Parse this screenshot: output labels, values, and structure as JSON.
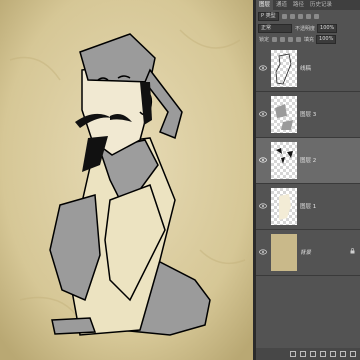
{
  "panel": {
    "tabs": [
      {
        "label": "图层"
      },
      {
        "label": "通道"
      },
      {
        "label": "路径"
      },
      {
        "label": "历史记录"
      }
    ],
    "kind_field": "P 类型",
    "blend_mode": "正常",
    "opacity_label": "不透明度",
    "opacity_value": "100%",
    "lock_label": "锁定",
    "fill_label": "填充",
    "fill_value": "100%"
  },
  "layers": [
    {
      "name": "线稿",
      "selected": false
    },
    {
      "name": "图层 3",
      "selected": false
    },
    {
      "name": "图层 2",
      "selected": true
    },
    {
      "name": "图层 1",
      "selected": false
    },
    {
      "name": "背景",
      "selected": false
    }
  ]
}
